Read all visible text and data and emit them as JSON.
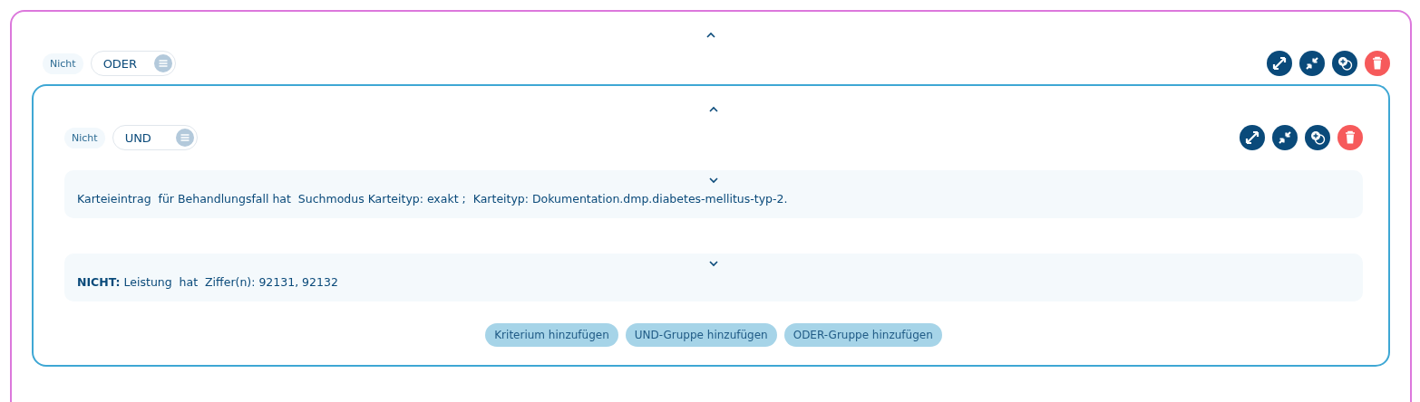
{
  "group": {
    "negate_label": "Nicht",
    "operator": "ODER",
    "child": {
      "negate_label": "Nicht",
      "operator": "UND",
      "criteria": [
        {
          "text": "Karteieintrag  für Behandlungsfall hat  Suchmodus Karteityp: exakt ;  Karteityp: Dokumentation.dmp.diabetes-mellitus-typ-2."
        },
        {
          "text": "**NICHT:** Leistung  hat  Ziffer(n): 92131, 92132"
        }
      ],
      "buttons": [
        "Kriterium hinzufügen",
        "UND-Gruppe hinzufügen",
        "ODER-Gruppe hinzufügen"
      ]
    }
  }
}
